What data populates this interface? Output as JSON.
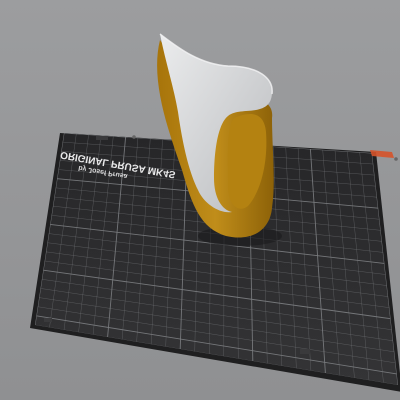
{
  "viewport": {
    "background_color": "#999a9c",
    "bed": {
      "logo_text": "ORIGINAL PRUSA MK4S",
      "logo_subtext": "by Josef Prusa",
      "plate_color": "#2d2d2f",
      "grid_color": "#7d7f82",
      "accent_color": "#e05a2b",
      "logo_color": "#e9e9ea"
    },
    "model": {
      "name": "shoe-insole-model",
      "inner_color": "#d4d6d8",
      "outer_color": "#b5830f"
    }
  }
}
